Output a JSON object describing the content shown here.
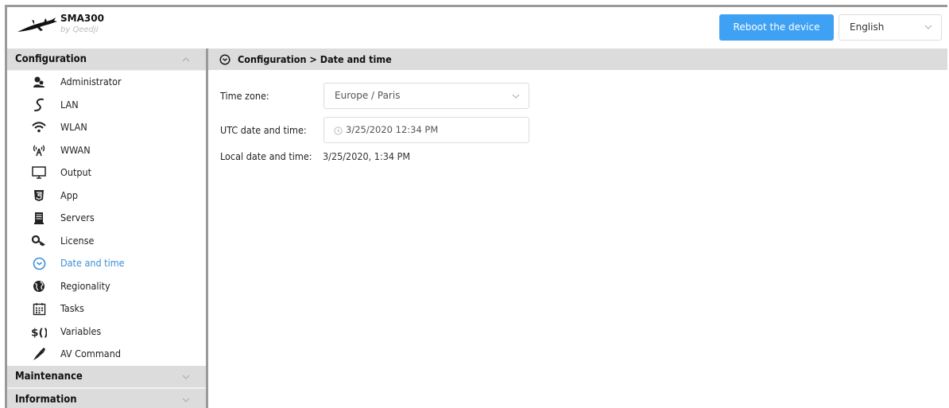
{
  "header": {
    "brand": "SMA300",
    "brand_sub": "by Qeedji",
    "reboot_label": "Reboot the device",
    "language": "English"
  },
  "sidebar": {
    "configuration_label": "Configuration",
    "items": [
      {
        "label": "Administrator",
        "icon": "administrator-icon"
      },
      {
        "label": "LAN",
        "icon": "lan-icon"
      },
      {
        "label": "WLAN",
        "icon": "wifi-icon"
      },
      {
        "label": "WWAN",
        "icon": "antenna-icon"
      },
      {
        "label": "Output",
        "icon": "monitor-icon"
      },
      {
        "label": "App",
        "icon": "html5-icon"
      },
      {
        "label": "Servers",
        "icon": "server-icon"
      },
      {
        "label": "License",
        "icon": "key-icon"
      },
      {
        "label": "Date and time",
        "icon": "clock-icon",
        "active": true
      },
      {
        "label": "Regionality",
        "icon": "globe-icon"
      },
      {
        "label": "Tasks",
        "icon": "calendar-icon"
      },
      {
        "label": "Variables",
        "icon": "variables-icon"
      },
      {
        "label": "AV Command",
        "icon": "pen-icon"
      }
    ],
    "maintenance_label": "Maintenance",
    "information_label": "Information"
  },
  "main": {
    "breadcrumb": "Configuration > Date and time",
    "timezone_label": "Time zone:",
    "timezone_value": "Europe / Paris",
    "utc_label": "UTC date and time:",
    "utc_value": "3/25/2020 12:34 PM",
    "local_label": "Local date and time:",
    "local_value": "3/25/2020, 1:34 PM"
  },
  "colors": {
    "accent": "#3ea1f4",
    "active_text": "#3a8fd6",
    "section_header": "#dcdcdc"
  }
}
